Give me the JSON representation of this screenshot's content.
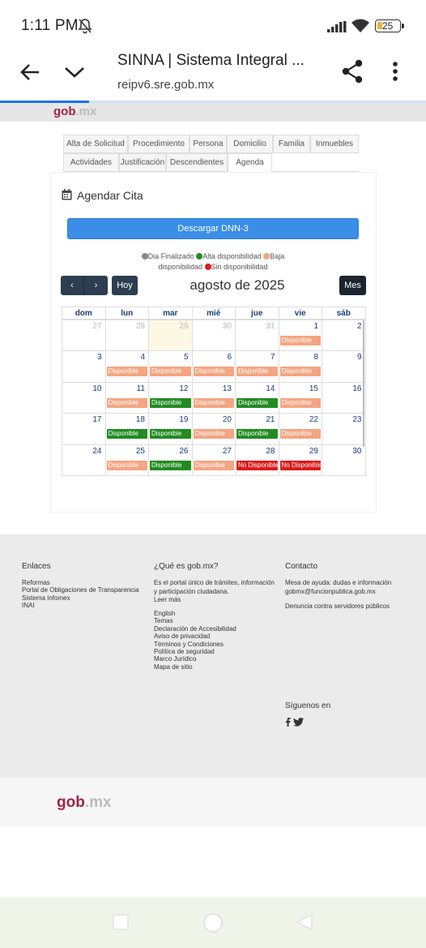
{
  "status_bar": {
    "time": "1:11 PM",
    "battery": "25"
  },
  "browser": {
    "title": "SINNA | Sistema Integral ...",
    "url": "reipv6.sre.gob.mx",
    "load_progress_percent": 21
  },
  "site": {
    "logo_gob": "gob",
    "logo_mx": ".mx"
  },
  "tabs": [
    {
      "label": "Alta de Solicitud",
      "active": false
    },
    {
      "label": "Procedimiento",
      "active": false
    },
    {
      "label": "Persona",
      "active": false
    },
    {
      "label": "Domicilio",
      "active": false
    },
    {
      "label": "Familia",
      "active": false
    },
    {
      "label": "Inmuebles",
      "active": false
    },
    {
      "label": "Actividades",
      "active": false
    },
    {
      "label": "Justificación",
      "active": false
    },
    {
      "label": "Descendientes",
      "active": false
    },
    {
      "label": "Agenda",
      "active": true
    }
  ],
  "agenda": {
    "title": "Agendar Cita",
    "download_label": "Descargar DNN-3",
    "legend": {
      "finalizado": "Dia Finalizado",
      "alta": "Alta disponibilidad",
      "baja": "Baja disponibilidad",
      "sin": "Sin disponibilidad"
    },
    "colors": {
      "finalizado": "#888888",
      "alta": "#228b22",
      "baja": "#f4a582",
      "sin": "#dd1a1a"
    }
  },
  "calendar": {
    "prev_icon": "‹",
    "next_icon": "›",
    "today_label": "Hoy",
    "title": "agosto de 2025",
    "month_label": "Mes",
    "weekdays": [
      "dom",
      "lun",
      "mar",
      "mié",
      "jue",
      "vie",
      "sáb"
    ],
    "weeks": [
      [
        {
          "d": "27",
          "other": true
        },
        {
          "d": "28",
          "other": true
        },
        {
          "d": "29",
          "other": true,
          "today": true
        },
        {
          "d": "30",
          "other": true
        },
        {
          "d": "31",
          "other": true
        },
        {
          "d": "1",
          "badge": "Disponible",
          "level": "baja"
        },
        {
          "d": "2"
        }
      ],
      [
        {
          "d": "3"
        },
        {
          "d": "4",
          "badge": "Disponible",
          "level": "baja"
        },
        {
          "d": "5",
          "badge": "Disponible",
          "level": "baja"
        },
        {
          "d": "6",
          "badge": "Disponible",
          "level": "baja"
        },
        {
          "d": "7",
          "badge": "Disponible",
          "level": "baja"
        },
        {
          "d": "8",
          "badge": "Disponible",
          "level": "baja"
        },
        {
          "d": "9"
        }
      ],
      [
        {
          "d": "10"
        },
        {
          "d": "11",
          "badge": "Disponible",
          "level": "baja"
        },
        {
          "d": "12",
          "badge": "Disponible",
          "level": "alta"
        },
        {
          "d": "13",
          "badge": "Disponible",
          "level": "baja"
        },
        {
          "d": "14",
          "badge": "Disponible",
          "level": "alta"
        },
        {
          "d": "15",
          "badge": "Disponible",
          "level": "baja"
        },
        {
          "d": "16"
        }
      ],
      [
        {
          "d": "17"
        },
        {
          "d": "18",
          "badge": "Disponible",
          "level": "alta"
        },
        {
          "d": "19",
          "badge": "Disponible",
          "level": "alta"
        },
        {
          "d": "20",
          "badge": "Disponible",
          "level": "baja"
        },
        {
          "d": "21",
          "badge": "Disponible",
          "level": "alta"
        },
        {
          "d": "22",
          "badge": "Disponible",
          "level": "baja"
        },
        {
          "d": "23"
        }
      ],
      [
        {
          "d": "24"
        },
        {
          "d": "25",
          "badge": "Disponible",
          "level": "baja"
        },
        {
          "d": "26",
          "badge": "Disponible",
          "level": "alta"
        },
        {
          "d": "27",
          "badge": "Disponible",
          "level": "baja"
        },
        {
          "d": "28",
          "badge": "No Disponible",
          "level": "sin"
        },
        {
          "d": "29",
          "badge": "No Disponible",
          "level": "sin"
        },
        {
          "d": "30"
        }
      ]
    ]
  },
  "footer": {
    "enlaces": {
      "title": "Enlaces",
      "links": [
        "Reformas",
        "Portal de Obligaciones de Transparencia",
        "Sistema Infomex",
        "INAI"
      ]
    },
    "que_es": {
      "title": "¿Qué es gob.mx?",
      "text": "Es el portal único de trámites, información y participación ciudadana.",
      "read_more": "Leer más",
      "links": [
        "English",
        "Temas",
        "Declaración de Accesibilidad",
        "Aviso de privacidad",
        "Términos y Condiciones",
        "Política de seguridad",
        "Marco Jurídico",
        "Mapa de sitio"
      ]
    },
    "contacto": {
      "title": "Contacto",
      "text": "Mesa de ayuda: dudas e información gobmx@funcionpublica.gob.mx",
      "denuncia": "Denuncia contra servidores públicos"
    },
    "follow": "Síguenos en",
    "social": [
      "facebook-icon",
      "twitter-icon"
    ]
  }
}
